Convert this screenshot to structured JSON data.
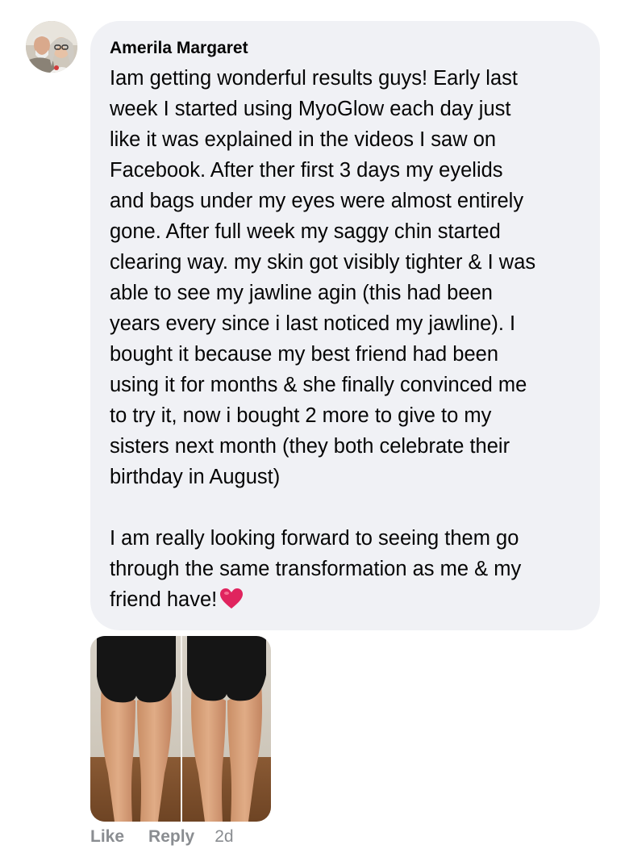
{
  "comment": {
    "author": "Amerila Margaret",
    "paragraph_1": "Iam getting wonderful results guys! Early last\nweek I started using MyoGlow each day just\nlike it was explained in the videos I saw on\nFacebook. After ther first 3 days my eyelids\nand bags under my eyes were almost entirely\ngone. After full week my saggy chin started\nclearing way. my skin got visibly tighter & I was\nable to see my jawline agin (this had been\nyears every since i last noticed my jawline). I\nbought it because my best friend had been\nusing it for months & she finally convinced me\nto try it, now i bought 2 more to give to my\nsisters next month (they both celebrate their\nbirthday in August)",
    "paragraph_2": "I am really looking forward to seeing them go\nthrough the same transformation as me & my\nfriend have!",
    "emoji": "heart-icon",
    "attached_image": "before-after-legs-photo"
  },
  "actions": {
    "like_label": "Like",
    "reply_label": "Reply",
    "timestamp": "2d"
  },
  "colors": {
    "bubble_bg": "#f0f1f5",
    "text": "#050505",
    "action_text": "#8a8d91",
    "heart": "#e0245e"
  }
}
